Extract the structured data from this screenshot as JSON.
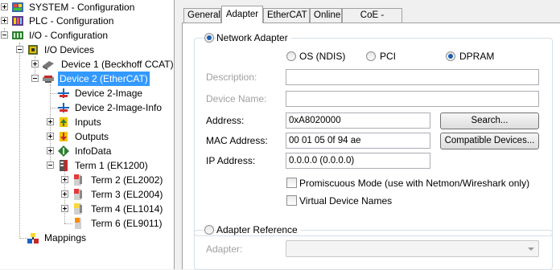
{
  "tree": {
    "items": [
      {
        "label": "SYSTEM - Configuration",
        "icon": "system-icon"
      },
      {
        "label": "PLC - Configuration",
        "icon": "plc-icon"
      },
      {
        "label": "I/O - Configuration",
        "icon": "io-config-icon"
      },
      {
        "label": "I/O Devices",
        "icon": "io-devices-icon"
      },
      {
        "label": "Device 1 (Beckhoff CCAT)",
        "icon": "device-icon"
      },
      {
        "label": "Device 2 (EtherCAT)",
        "icon": "ethercat-device-icon",
        "selected": true
      },
      {
        "label": "Device 2-Image",
        "icon": "image-icon"
      },
      {
        "label": "Device 2-Image-Info",
        "icon": "image-info-icon"
      },
      {
        "label": "Inputs",
        "icon": "inputs-icon"
      },
      {
        "label": "Outputs",
        "icon": "outputs-icon"
      },
      {
        "label": "InfoData",
        "icon": "infodata-icon"
      },
      {
        "label": "Term 1 (EK1200)",
        "icon": "coupler-icon"
      },
      {
        "label": "Term 2 (EL2002)",
        "icon": "terminal-red-icon"
      },
      {
        "label": "Term 3 (EL2004)",
        "icon": "terminal-red-icon"
      },
      {
        "label": "Term 4 (EL1014)",
        "icon": "terminal-yellow-icon"
      },
      {
        "label": "Term 6 (EL9011)",
        "icon": "terminal-end-icon"
      },
      {
        "label": "Mappings",
        "icon": "mappings-icon"
      }
    ]
  },
  "tabs": [
    "General",
    "Adapter",
    "EtherCAT",
    "Online",
    "CoE - Online"
  ],
  "active_tab": "Adapter",
  "adapter": {
    "network_adapter_label": "Network Adapter",
    "network_adapter_selected": true,
    "os_label": "OS (NDIS)",
    "pci_label": "PCI",
    "dpram_label": "DPRAM",
    "dpram_selected": true,
    "description_label": "Description:",
    "description_value": "",
    "device_name_label": "Device Name:",
    "device_name_value": "",
    "address_label": "Address:",
    "address_value": "0xA8020000",
    "search_button": "Search...",
    "mac_label": "MAC Address:",
    "mac_value": "00 01 05 0f 94 ae",
    "compatible_button": "Compatible Devices...",
    "ip_label": "IP Address:",
    "ip_value": "0.0.0.0 (0.0.0.0)",
    "promiscuous_label": "Promiscuous Mode (use with Netmon/Wireshark only)",
    "promiscuous_checked": false,
    "virtual_names_label": "Virtual Device Names",
    "virtual_names_checked": false,
    "adapter_reference_label": "Adapter Reference",
    "adapter_reference_selected": false,
    "adapter_label": "Adapter:",
    "adapter_value": ""
  },
  "colors": {
    "selection": "#3399ff",
    "radio_dot": "#1a5fb4",
    "disabled_text": "#a0a0a0"
  }
}
